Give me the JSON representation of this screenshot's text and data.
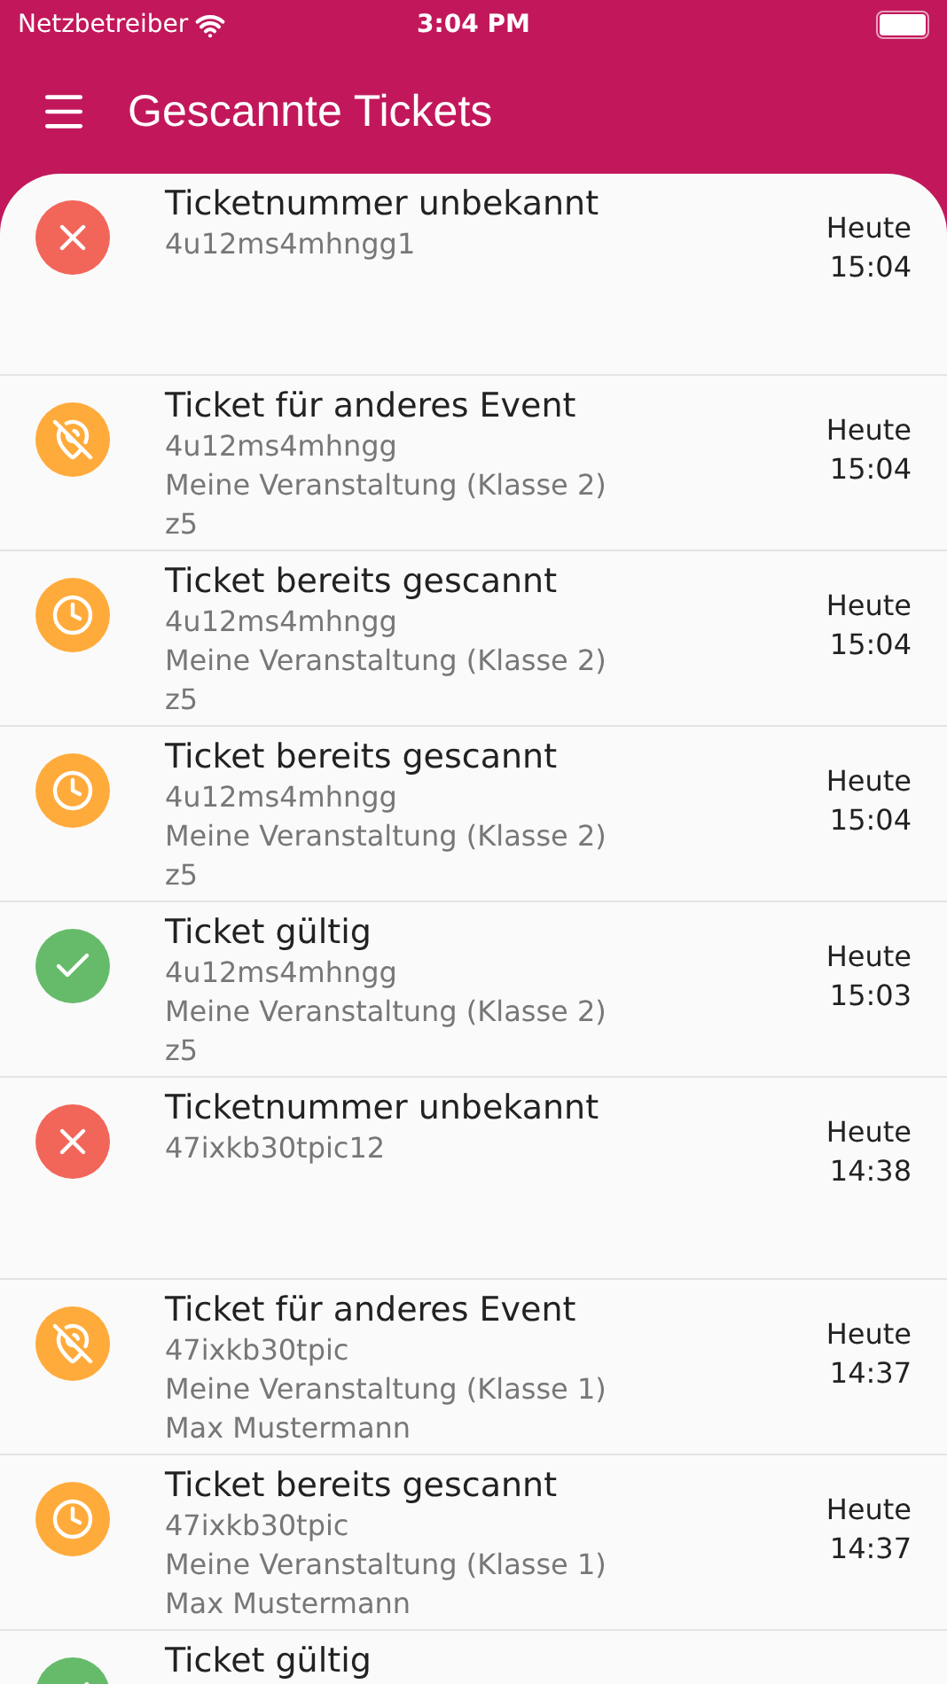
{
  "status_bar": {
    "carrier": "Netzbetreiber",
    "time": "3:04 PM"
  },
  "app_bar": {
    "title": "Gescannte Tickets"
  },
  "tickets": [
    {
      "kind": "unknown",
      "title": "Ticketnummer unbekannt",
      "lines": [
        "4u12ms4mhngg1"
      ],
      "day": "Heute",
      "time": "15:04"
    },
    {
      "kind": "other_event",
      "title": "Ticket für anderes Event",
      "lines": [
        "4u12ms4mhngg",
        "Meine Veranstaltung (Klasse 2)",
        "z5"
      ],
      "day": "Heute",
      "time": "15:04"
    },
    {
      "kind": "already_scanned",
      "title": "Ticket bereits gescannt",
      "lines": [
        "4u12ms4mhngg",
        "Meine Veranstaltung (Klasse 2)",
        "z5"
      ],
      "day": "Heute",
      "time": "15:04"
    },
    {
      "kind": "already_scanned",
      "title": "Ticket bereits gescannt",
      "lines": [
        "4u12ms4mhngg",
        "Meine Veranstaltung (Klasse 2)",
        "z5"
      ],
      "day": "Heute",
      "time": "15:04"
    },
    {
      "kind": "valid",
      "title": "Ticket gültig",
      "lines": [
        "4u12ms4mhngg",
        "Meine Veranstaltung (Klasse 2)",
        "z5"
      ],
      "day": "Heute",
      "time": "15:03"
    },
    {
      "kind": "unknown",
      "title": "Ticketnummer unbekannt",
      "lines": [
        "47ixkb30tpic12"
      ],
      "day": "Heute",
      "time": "14:38"
    },
    {
      "kind": "other_event",
      "title": "Ticket für anderes Event",
      "lines": [
        "47ixkb30tpic",
        "Meine Veranstaltung (Klasse 1)",
        "Max Mustermann"
      ],
      "day": "Heute",
      "time": "14:37"
    },
    {
      "kind": "already_scanned",
      "title": "Ticket bereits gescannt",
      "lines": [
        "47ixkb30tpic",
        "Meine Veranstaltung (Klasse 1)",
        "Max Mustermann"
      ],
      "day": "Heute",
      "time": "14:37"
    },
    {
      "kind": "valid",
      "title": "Ticket gültig"
    }
  ]
}
